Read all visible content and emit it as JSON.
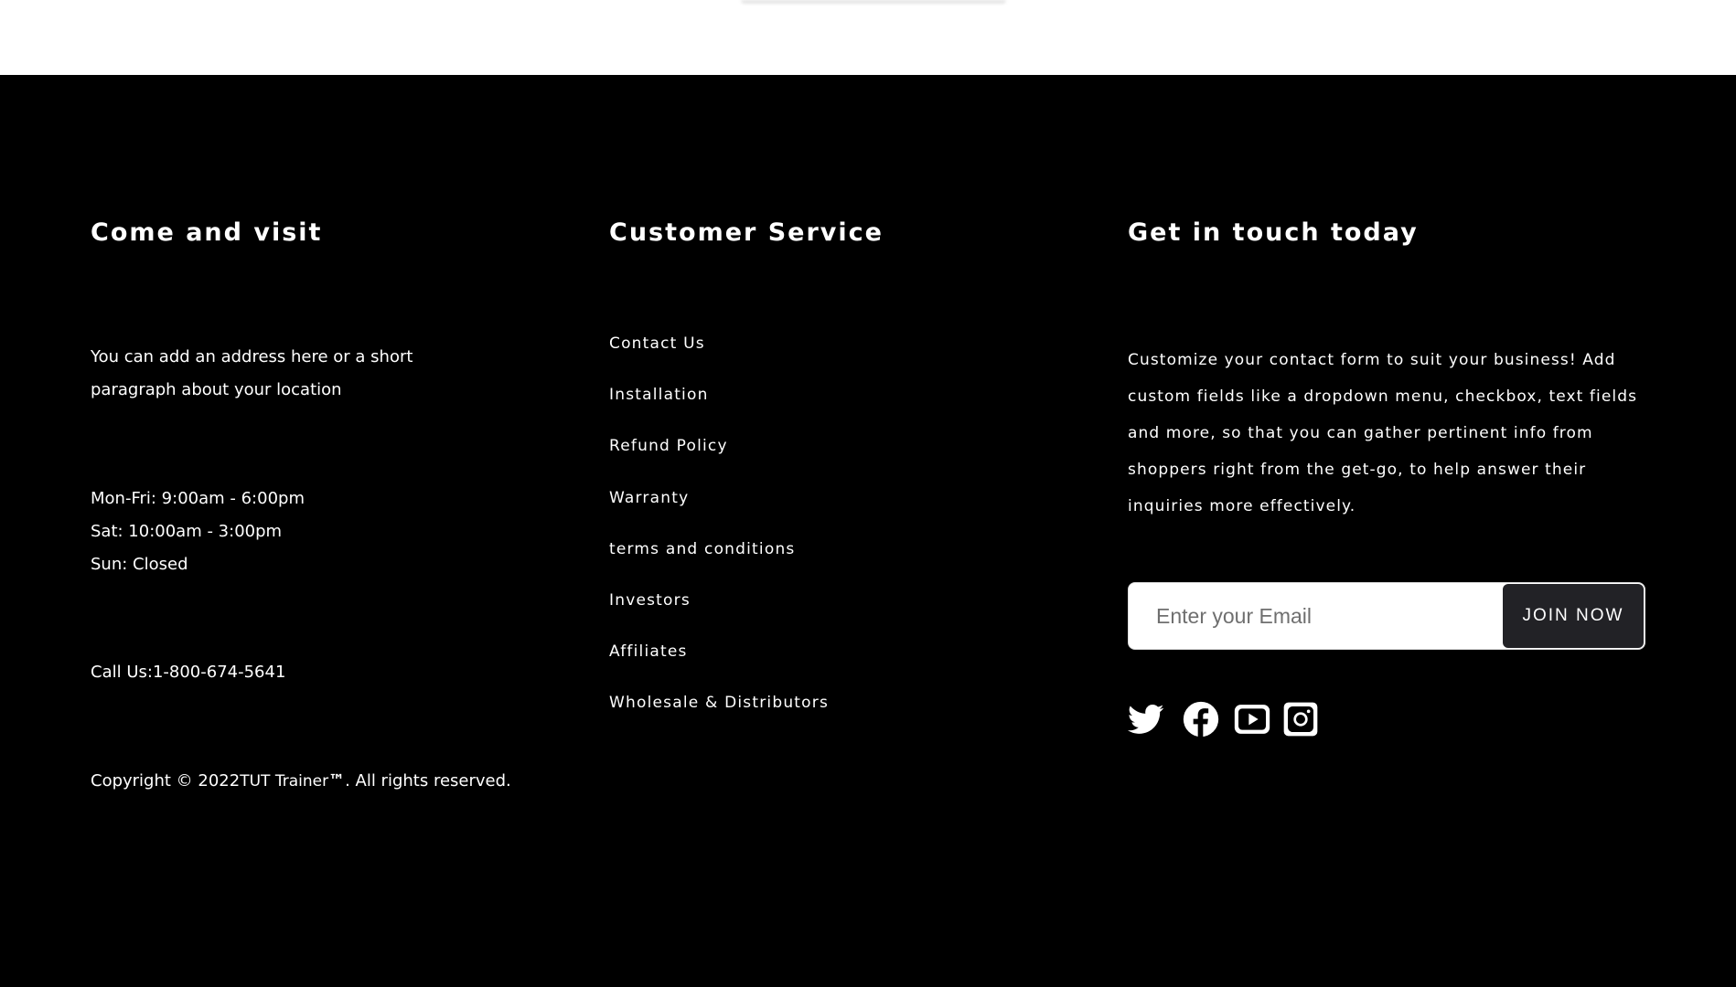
{
  "visit": {
    "heading": "Come and visit",
    "address": "You can add an address here or a short paragraph about your location",
    "hours": [
      "Mon-Fri: 9:00am - 6:00pm",
      "Sat: 10:00am - 3:00pm",
      "Sun: Closed"
    ],
    "call_label": "Call Us:",
    "call_number": "1-800-674-5641",
    "copyright_prefix": "Copyright © 2022",
    "copyright_brand": "TUT Trainer",
    "copyright_tm": "™",
    "copyright_suffix": ". All rights reserved."
  },
  "service": {
    "heading": "Customer Service",
    "links": [
      "Contact Us",
      "Installation",
      "Refund Policy",
      "Warranty",
      "terms and conditions",
      "Investors",
      "Affiliates",
      "Wholesale & Distributors"
    ]
  },
  "touch": {
    "heading": "Get in touch today",
    "text": "Customize your contact form to suit your business! Add custom fields like a dropdown menu, checkbox, text fields and more, so that you can gather pertinent info from shoppers right from the get-go, to help answer their inquiries more effectively.",
    "email_placeholder": "Enter your Email",
    "email_value": "",
    "join_label": "JOIN NOW",
    "socials": [
      "twitter-icon",
      "facebook-icon",
      "youtube-icon",
      "instagram-icon"
    ]
  },
  "colors": {
    "background": "#000000",
    "text": "#ffffff",
    "button": "#222226"
  }
}
